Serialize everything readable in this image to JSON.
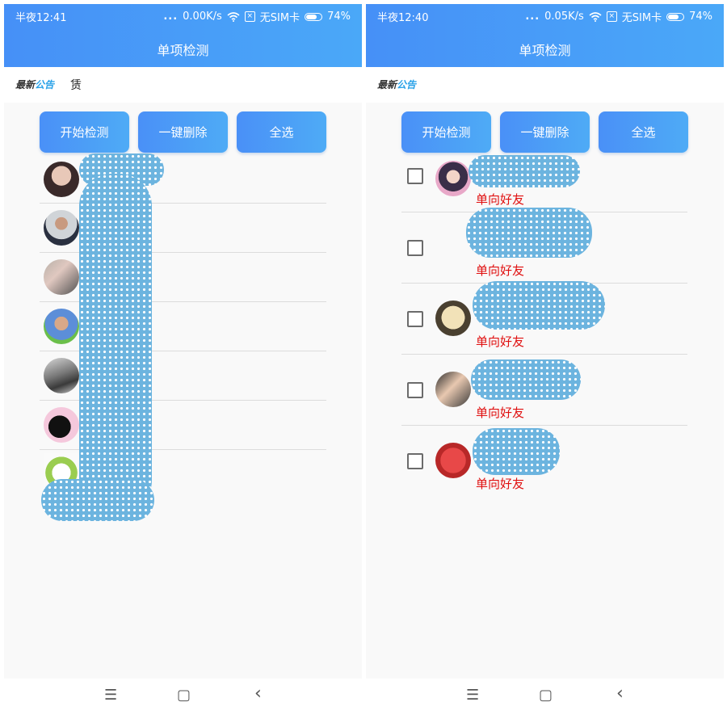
{
  "screens": [
    {
      "status": {
        "time": "半夜12:41",
        "signal_dots": "...",
        "speed": "0.00K/s",
        "sim": "无SIM卡",
        "battery": "74%",
        "battery_level": 0.74
      },
      "title": "单项检测",
      "notice": {
        "logo_part1": "最新",
        "logo_part2": "公告",
        "text": "赁"
      },
      "buttons": [
        "开始检测",
        "一键删除",
        "全选"
      ]
    },
    {
      "status": {
        "time": "半夜12:40",
        "signal_dots": "...",
        "speed": "0.05K/s",
        "sim": "无SIM卡",
        "battery": "74%",
        "battery_level": 0.74
      },
      "title": "单项检测",
      "notice": {
        "logo_part1": "最新",
        "logo_part2": "公告",
        "text": ""
      },
      "buttons": [
        "开始检测",
        "一键删除",
        "全选"
      ],
      "friends": [
        {
          "tag": "单向好友"
        },
        {
          "tag": "单向好友"
        },
        {
          "tag": "单向好友"
        },
        {
          "tag": "单向好友"
        },
        {
          "tag": "单向好友"
        }
      ]
    }
  ],
  "colors": {
    "header_start": "#4690f7",
    "header_end": "#4aa8f8",
    "tag_red": "#e01010",
    "redaction": "#6cb4df"
  },
  "nav": {
    "menu_icon": "☰",
    "home_icon": "▢",
    "back_icon": "‹"
  }
}
